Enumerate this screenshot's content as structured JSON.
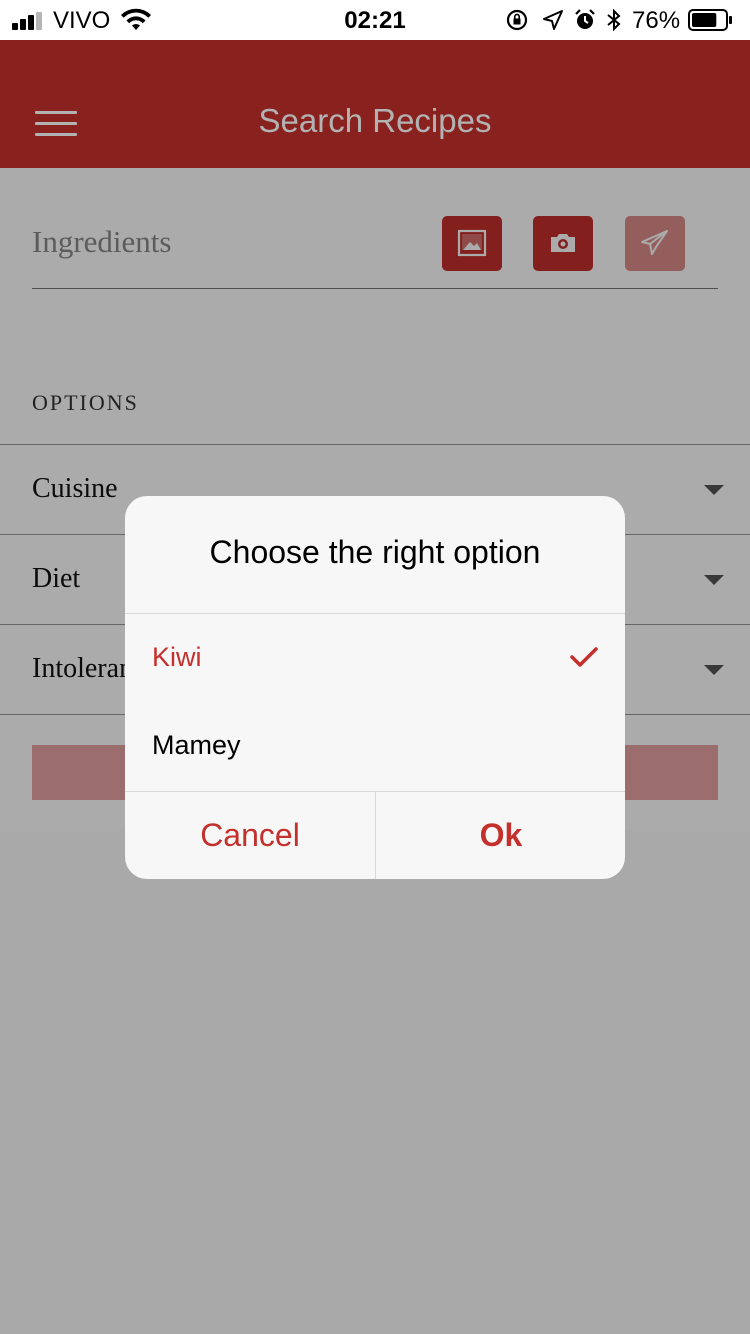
{
  "status_bar": {
    "carrier": "VIVO",
    "time": "02:21",
    "battery_percent": "76%",
    "battery_level": 0.76,
    "icons": [
      "signal-icon",
      "wifi-icon",
      "orientation-lock-icon",
      "location-icon",
      "alarm-icon",
      "bluetooth-icon",
      "battery-icon"
    ]
  },
  "header": {
    "title": "Search Recipes",
    "menu_icon": "hamburger-menu-icon",
    "background_color": "#c4302c"
  },
  "search": {
    "placeholder": "Ingredients",
    "buttons": [
      {
        "icon": "image-icon",
        "enabled": true
      },
      {
        "icon": "camera-icon",
        "enabled": true
      },
      {
        "icon": "send-icon",
        "enabled": false
      }
    ]
  },
  "options": {
    "heading": "OPTIONS",
    "rows": [
      {
        "label": "Cuisine"
      },
      {
        "label": "Diet"
      },
      {
        "label": "Intolerances"
      }
    ]
  },
  "dialog": {
    "title": "Choose the right option",
    "options": [
      {
        "label": "Kiwi",
        "selected": true
      },
      {
        "label": "Mamey",
        "selected": false
      }
    ],
    "cancel_label": "Cancel",
    "ok_label": "Ok",
    "accent_color": "#c4302c"
  }
}
